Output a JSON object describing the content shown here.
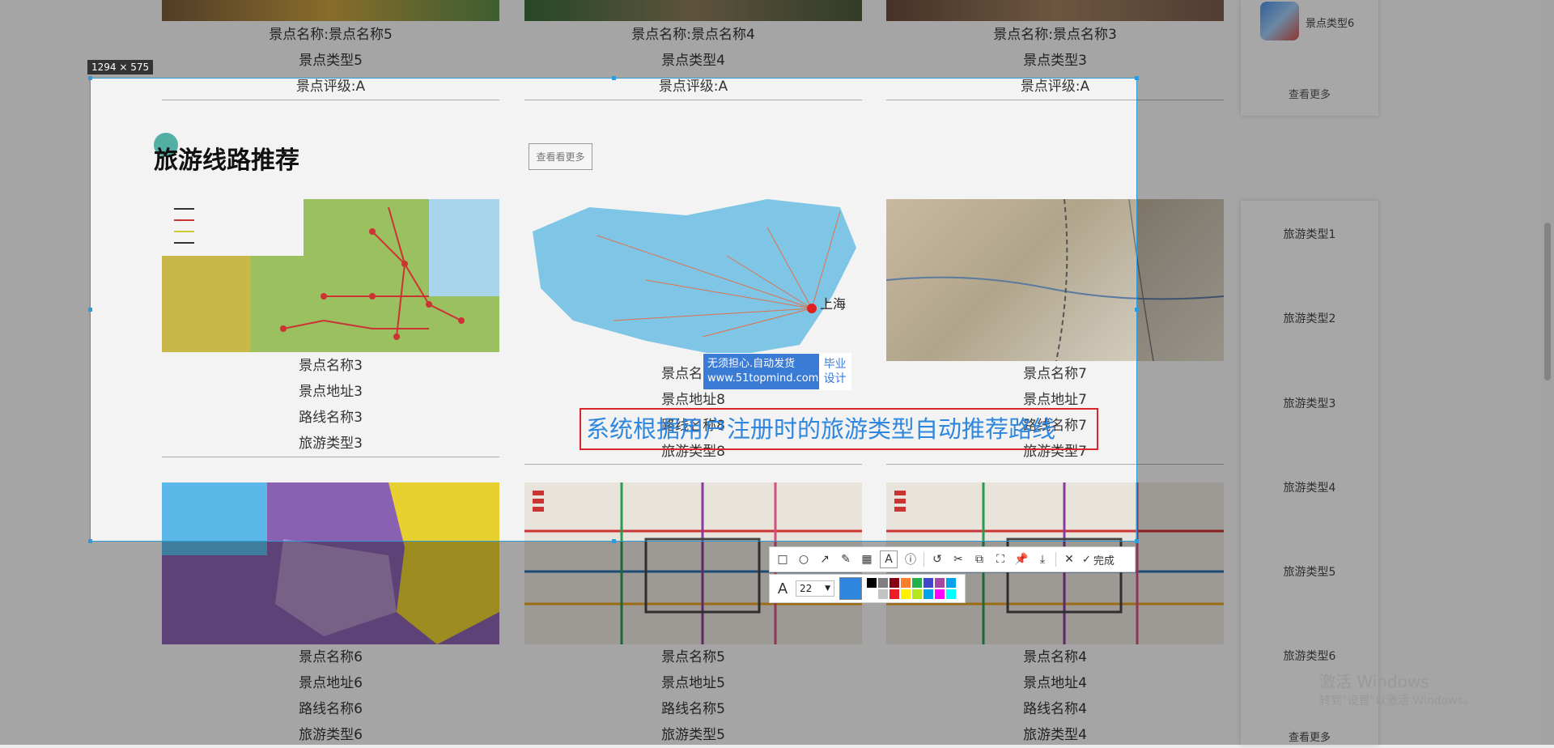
{
  "top_cards": [
    {
      "name": "景点名称:景点名称5",
      "type": "景点类型5",
      "rating": "景点评级:A"
    },
    {
      "name": "景点名称:景点名称4",
      "type": "景点类型4",
      "rating": "景点评级:A"
    },
    {
      "name": "景点名称:景点名称3",
      "type": "景点类型3",
      "rating": "景点评级:A"
    }
  ],
  "section": {
    "title": "旅游线路推荐",
    "more_label": "查看看更多"
  },
  "route_row1": [
    {
      "name": "景点名称3",
      "address": "景点地址3",
      "route": "路线名称3",
      "type": "旅游类型3"
    },
    {
      "name": "景点名称8",
      "address": "景点地址8",
      "route": "路线名称8",
      "type": "旅游类型8"
    },
    {
      "name": "景点名称7",
      "address": "景点地址7",
      "route": "路线名称7",
      "type": "旅游类型7"
    }
  ],
  "route_row2": [
    {
      "name": "景点名称6",
      "address": "景点地址6",
      "route": "路线名称6",
      "type": "旅游类型6"
    },
    {
      "name": "景点名称5",
      "address": "景点地址5",
      "route": "路线名称5",
      "type": "旅游类型5"
    },
    {
      "name": "景点名称4",
      "address": "景点地址4",
      "route": "路线名称4",
      "type": "旅游类型4"
    }
  ],
  "map_labels": {
    "shanghai": "上海"
  },
  "side_top": {
    "item_label": "景点类型6",
    "more_label": "查看更多"
  },
  "side_bottom": {
    "items": [
      "旅游类型1",
      "旅游类型2",
      "旅游类型3",
      "旅游类型4",
      "旅游类型5",
      "旅游类型6"
    ],
    "more_label": "查看更多"
  },
  "screenshot_tool": {
    "size_label": "1294 × 575",
    "done_label": "完成",
    "font_size": "22",
    "annotation_text": "系统根据用户注册时的旅游类型自动推荐路线",
    "current_color": "#2e86de",
    "palette": [
      "#000000",
      "#7f7f7f",
      "#880015",
      "#ff7f27",
      "#22b14c",
      "#3f48cc",
      "#a349a4",
      "#00a2e8",
      "#ffffff",
      "#c3c3c3",
      "#ed1c24",
      "#fff200",
      "#b5e61d",
      "#00a2e8",
      "#ff00ff",
      "#00ffff"
    ]
  },
  "watermark": {
    "line1": "无须担心.自动发货",
    "line2": "www.51topmind.com",
    "right1": "毕业",
    "right2": "设计"
  },
  "windows_activation": {
    "line1": "激活 Windows",
    "line2": "转到\"设置\"以激活 Windows。"
  }
}
